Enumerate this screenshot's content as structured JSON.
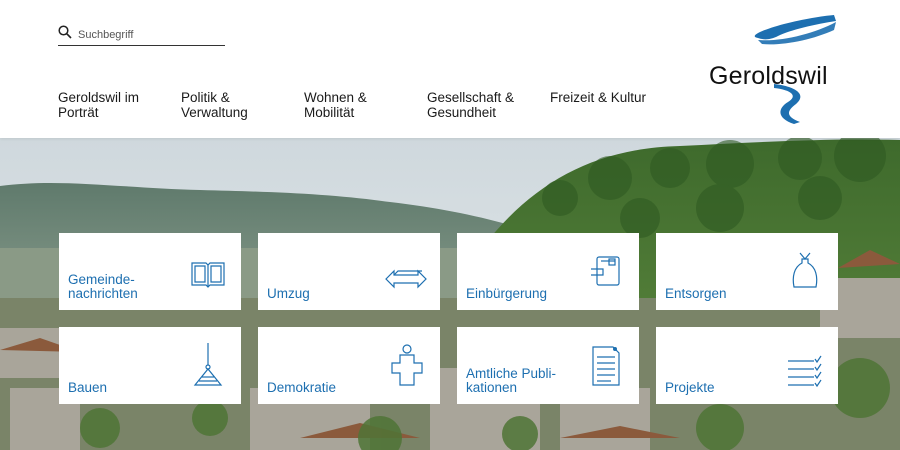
{
  "search": {
    "placeholder": "Suchbegriff",
    "icon": "search-icon"
  },
  "nav": {
    "items": [
      {
        "line1": "Geroldswil im",
        "line2": "Porträt"
      },
      {
        "line1": "Politik &",
        "line2": "Verwaltung"
      },
      {
        "line1": "Wohnen &",
        "line2": "Mobilität"
      },
      {
        "line1": "Gesellschaft &",
        "line2": "Gesundheit"
      },
      {
        "line1": "Freizeit & Kultur",
        "line2": ""
      }
    ]
  },
  "logo": {
    "text": "Geroldswil",
    "color": "#1d6fb0"
  },
  "colors": {
    "accent": "#1d6fb0",
    "text": "#1a1a1a"
  },
  "tiles": [
    {
      "line1": "Gemeinde-",
      "line2": "nachrichten",
      "icon": "book-icon"
    },
    {
      "line1": "Umzug",
      "line2": "",
      "icon": "moving-arrow-icon"
    },
    {
      "line1": "Einbürgerung",
      "line2": "",
      "icon": "passport-icon"
    },
    {
      "line1": "Entsorgen",
      "line2": "",
      "icon": "trash-bag-icon"
    },
    {
      "line1": "Bauen",
      "line2": "",
      "icon": "crane-icon"
    },
    {
      "line1": "Demokratie",
      "line2": "",
      "icon": "ballot-person-icon"
    },
    {
      "line1": "Amtliche Publi-",
      "line2": "kationen",
      "icon": "document-icon"
    },
    {
      "line1": "Projekte",
      "line2": "",
      "icon": "checklist-icon"
    }
  ]
}
